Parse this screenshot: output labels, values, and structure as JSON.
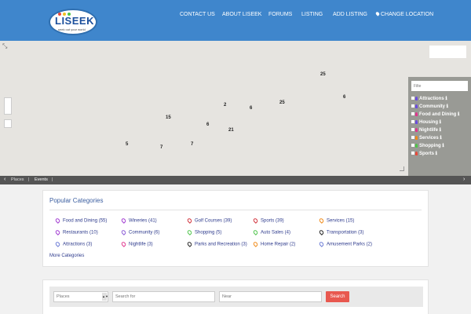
{
  "header": {
    "logo": {
      "brand": "LISEEK",
      "tagline": "seek out your world"
    },
    "nav": [
      {
        "id": "contact",
        "label": "CONTACT US"
      },
      {
        "id": "about",
        "label": "ABOUT LISEEK"
      },
      {
        "id": "forums",
        "label": "FORUMS"
      },
      {
        "id": "listing",
        "label": "LISTING"
      },
      {
        "id": "add-listing",
        "label": "ADD LISTING"
      },
      {
        "id": "change-location",
        "label": "CHANGE LOCATION"
      }
    ]
  },
  "map": {
    "clusters": [
      "25",
      "6",
      "2",
      "6",
      "25",
      "15",
      "6",
      "21",
      "5",
      "7",
      "7"
    ],
    "filter": {
      "placeholder": "Filte",
      "items": [
        {
          "label": "Attractions",
          "color": "#6b4de0"
        },
        {
          "label": "Community",
          "color": "#6b4de0"
        },
        {
          "label": "Food and Dining",
          "color": "#e0358e"
        },
        {
          "label": "Housing",
          "color": "#6b4de0"
        },
        {
          "label": "Nightlife",
          "color": "#e0358e"
        },
        {
          "label": "Services",
          "color": "#f08a18"
        },
        {
          "label": "Shopping",
          "color": "#4ec44a"
        },
        {
          "label": "Sports",
          "color": "#e84a3a"
        }
      ]
    }
  },
  "bottom_bar": {
    "places": "Places",
    "sep": "|",
    "events": "Events",
    "sep2": "|"
  },
  "popular": {
    "title": "Popular Categories",
    "categories": [
      {
        "label": "Food and Dining (55)",
        "color": "#a13bd1"
      },
      {
        "label": "Wineries (41)",
        "color": "#a13bd1"
      },
      {
        "label": "Golf Courses (39)",
        "color": "#d1313b"
      },
      {
        "label": "Sports (39)",
        "color": "#d1313b"
      },
      {
        "label": "Services (15)",
        "color": "#f08a18"
      },
      {
        "label": "Restaurants (10)",
        "color": "#a13bd1"
      },
      {
        "label": "Community (6)",
        "color": "#8a5bd6"
      },
      {
        "label": "Shopping (5)",
        "color": "#4ec44a"
      },
      {
        "label": "Auto Sales (4)",
        "color": "#4ec44a"
      },
      {
        "label": "Transportation (3)",
        "color": "#222222"
      },
      {
        "label": "Attractions (3)",
        "color": "#6b7bd6"
      },
      {
        "label": "Nightlife (3)",
        "color": "#e0358e"
      },
      {
        "label": "Parks and Recreation (3)",
        "color": "#222222"
      },
      {
        "label": "Home Repair (2)",
        "color": "#f08a18"
      },
      {
        "label": "Amusement Parks (2)",
        "color": "#6b7bd6"
      }
    ],
    "more": "More Categories"
  },
  "search": {
    "type_value": "Places",
    "for_placeholder": "Search for",
    "near_placeholder": "Near",
    "button": "Search"
  }
}
